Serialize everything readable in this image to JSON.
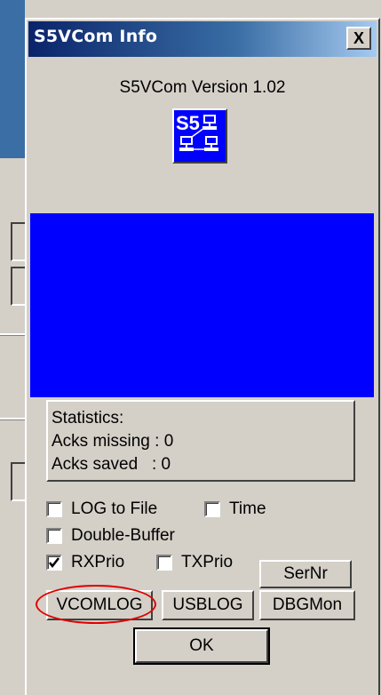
{
  "window": {
    "title": "S5VCom Info",
    "close_label": "X"
  },
  "header": {
    "version_text": "S5VCom Version 1.02",
    "logo_text": "S5",
    "logo_icon": "network-icon"
  },
  "statistics": {
    "heading": "Statistics:",
    "acks_missing": "Acks missing : 0",
    "acks_saved": "Acks saved   : 0"
  },
  "options": {
    "log_to_file": {
      "label": "LOG to File",
      "checked": false
    },
    "time": {
      "label": "Time",
      "checked": false
    },
    "double_buffer": {
      "label": "Double-Buffer",
      "checked": false
    },
    "rx_prio": {
      "label": "RXPrio",
      "checked": true
    },
    "tx_prio": {
      "label": "TXPrio",
      "checked": false
    }
  },
  "buttons": {
    "sernr": "SerNr",
    "vcomlog": "VCOMLOG",
    "usblog": "USBLOG",
    "dbgmon": "DBGMon",
    "ok": "OK"
  },
  "colors": {
    "title_bar": "#0a246a",
    "display_area": "#0000ff",
    "annotation": "#e00000"
  }
}
